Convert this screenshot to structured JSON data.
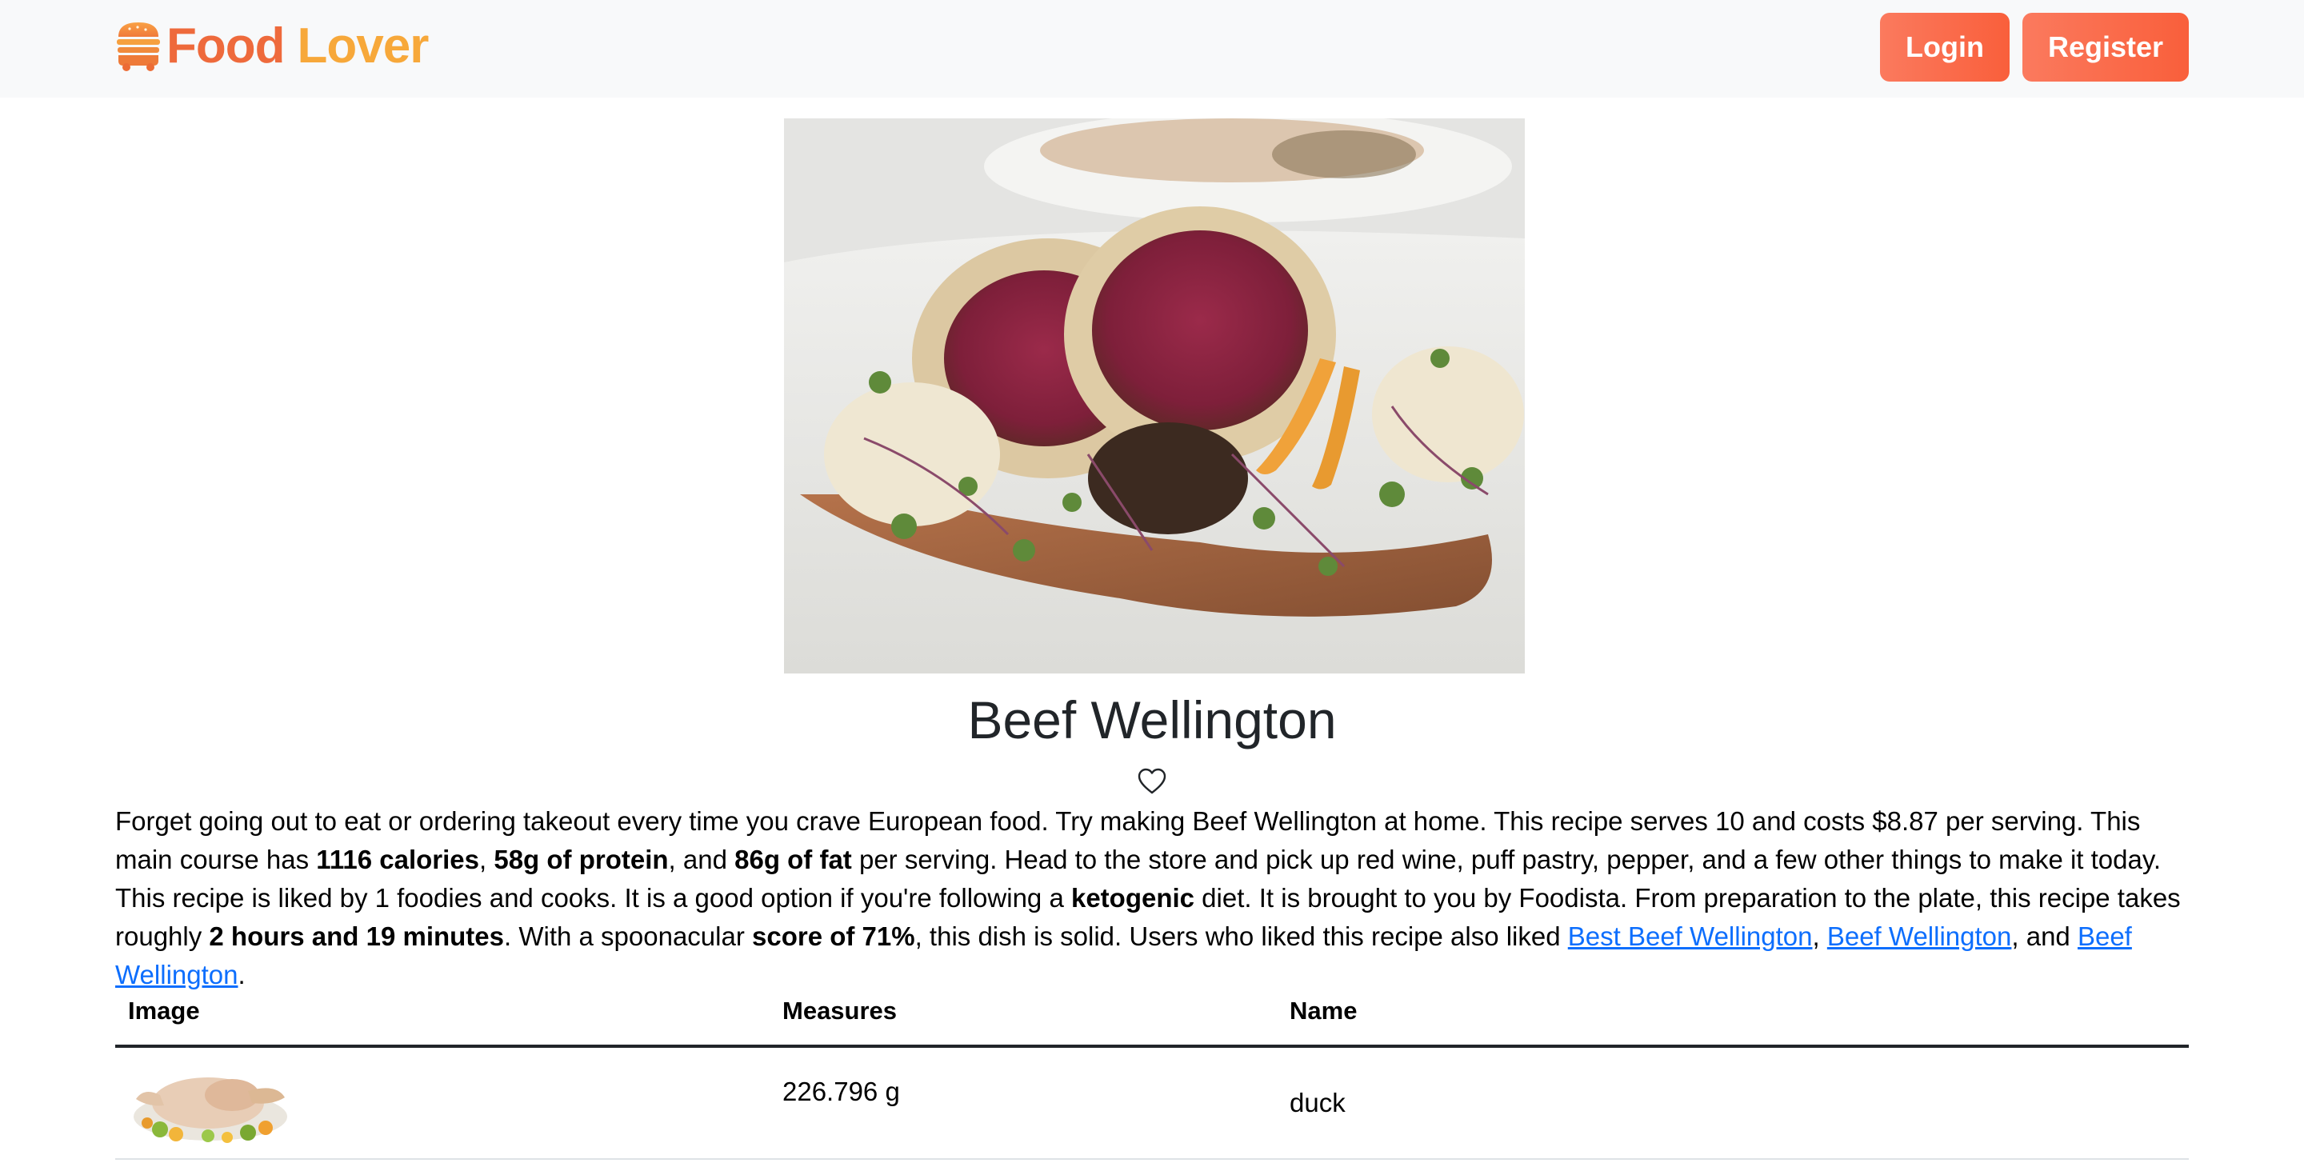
{
  "navbar": {
    "brand_first": "Food",
    "brand_second": "Lover",
    "brand_icon": "burger-icon",
    "login_label": "Login",
    "register_label": "Register",
    "brand_colors": {
      "food": "#ee6a3c",
      "lover": "#f7a83a",
      "button": "#f95f3b"
    }
  },
  "recipe": {
    "title": "Beef Wellington",
    "favorite_icon": "heart-outline-icon",
    "summary": {
      "p1": "Forget going out to eat or ordering takeout every time you crave European food. Try making Beef Wellington at home. This recipe serves 10 and costs $8.87 per serving. This main course has ",
      "calories": "1116 calories",
      "sep1": ", ",
      "protein": "58g of protein",
      "sep2": ", and ",
      "fat": "86g of fat",
      "p2": " per serving. Head to the store and pick up red wine, puff pastry, pepper, and a few other things to make it today. This recipe is liked by 1 foodies and cooks. It is a good option if you're following a ",
      "diet": "ketogenic",
      "p3": " diet. It is brought to you by Foodista. From preparation to the plate, this recipe takes roughly ",
      "time": "2 hours and 19 minutes",
      "p4": ". With a spoonacular ",
      "score": "score of 71%",
      "p5": ", this dish is solid. Users who liked this recipe also liked ",
      "link1": "Best Beef Wellington",
      "sep3": ", ",
      "link2": "Beef Wellington",
      "sep4": ", and ",
      "link3": "Beef Wellington",
      "end": "."
    }
  },
  "ingredients": {
    "headers": {
      "image": "Image",
      "measures": "Measures",
      "name": "Name"
    },
    "rows": [
      {
        "image": "duck-photo",
        "measure": "226.796 g",
        "name": "duck"
      }
    ]
  }
}
